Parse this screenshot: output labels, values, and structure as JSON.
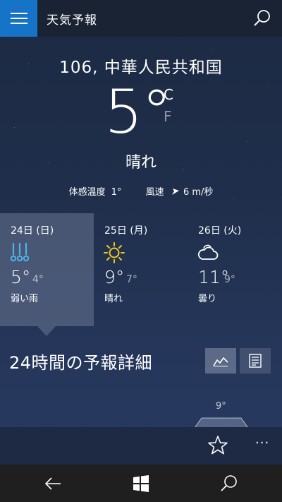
{
  "header": {
    "title": "天気予報"
  },
  "current": {
    "location": "106, 中華人民共和国",
    "temperature": "5°",
    "unit_c": "C",
    "unit_f": "F",
    "condition": "晴れ",
    "feels_like_label": "体感温度",
    "feels_like_value": "1°",
    "wind_label": "風速",
    "wind_value": "6 m/秒"
  },
  "forecast": [
    {
      "date": "24日 (日)",
      "high": "5°",
      "low": "4°",
      "desc": "弱い雨",
      "icon": "rain-icon",
      "selected": true
    },
    {
      "date": "25日 (月)",
      "high": "9°",
      "low": "7°",
      "desc": "晴れ",
      "icon": "sun-icon",
      "selected": false
    },
    {
      "date": "26日 (火)",
      "high": "11°",
      "low": "9°",
      "desc": "曇り",
      "icon": "cloud-icon",
      "selected": false
    }
  ],
  "hourly": {
    "title": "24時間の予報詳細",
    "first_temp": "9°"
  },
  "colors": {
    "accent": "#1674c8",
    "rain": "#4fb3ea",
    "sun": "#f3c623"
  }
}
